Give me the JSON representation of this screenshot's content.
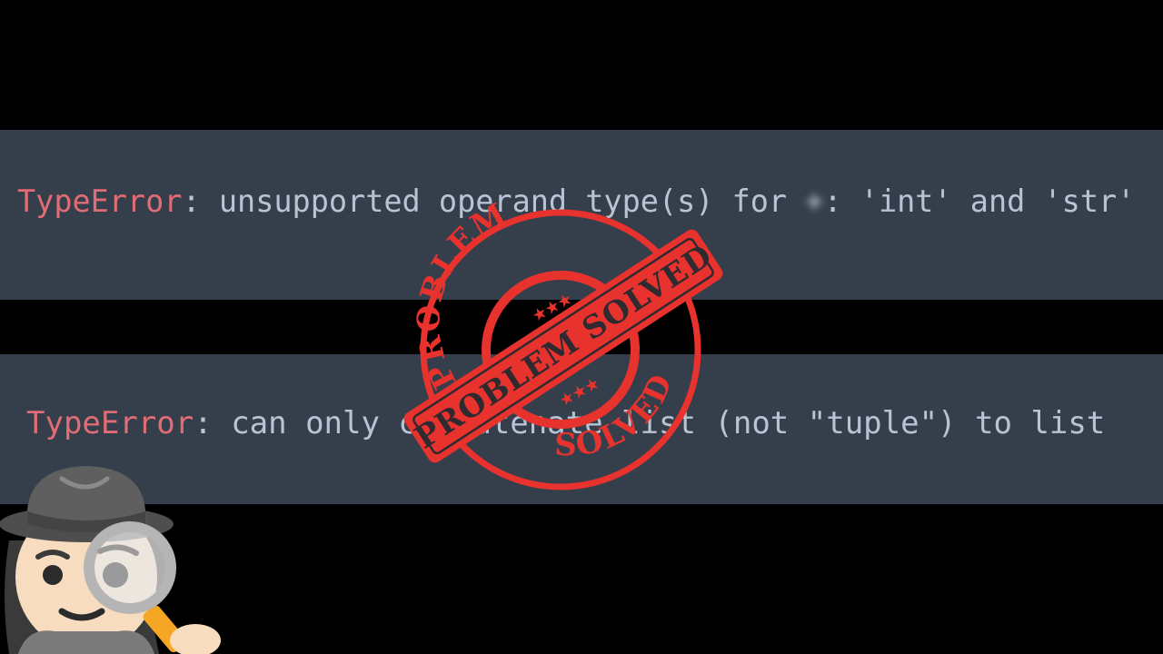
{
  "errors": [
    {
      "type": "TypeError",
      "separator": ": ",
      "message_before": "unsupported operand type(s) for ",
      "obscured_operator": "+",
      "message_after": ": 'int' and 'str'"
    },
    {
      "type": "TypeError",
      "separator": ": ",
      "message": "can only concatenate list (not \"tuple\") to list"
    }
  ],
  "stamp": {
    "top_arc_text": "PROBLEM",
    "bottom_arc_text": "SOLVED",
    "banner_text": "PROBLEM SOLVED",
    "stars": "★★★",
    "color": "#e8322e"
  },
  "colors": {
    "background": "#000000",
    "band": "#353e4b",
    "error_type": "#e06c75",
    "message": "#b8c4d6"
  },
  "emoji": {
    "name": "woman-detective",
    "skin": "#f7dcc0",
    "hat": "#5b5b5b",
    "handle": "#f5a623"
  }
}
